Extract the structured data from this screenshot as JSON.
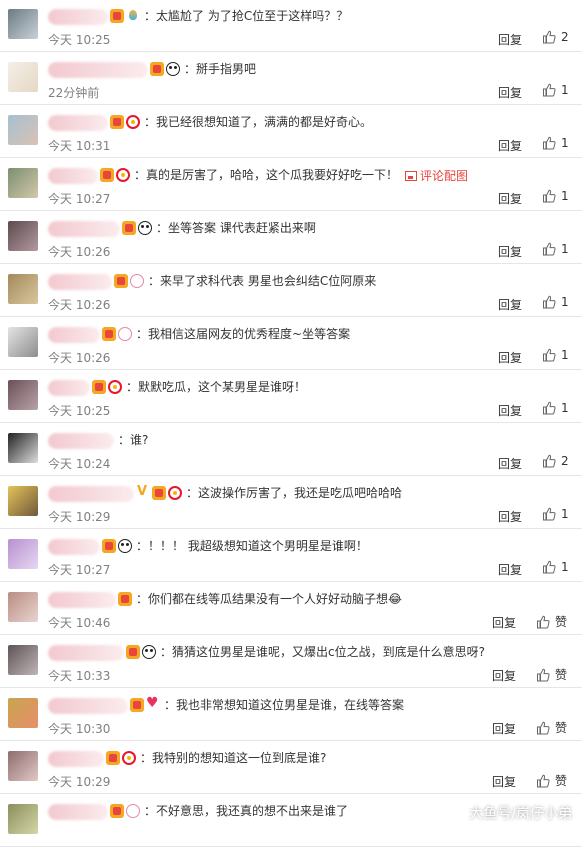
{
  "comments": [
    {
      "avatar_colors": [
        "#6b7b84",
        "#c9d1d6"
      ],
      "badges": [
        "vip",
        "bulb"
      ],
      "name_w": 60,
      "text": "太尴尬了 为了抢C位至于这样吗？？",
      "time": "今天 10:25",
      "reply": "回复",
      "likes": "2"
    },
    {
      "avatar_colors": [
        "#f3efe8",
        "#e6d8c4"
      ],
      "badges": [
        "vip",
        "panda"
      ],
      "name_w": 100,
      "text": "掰手指男吧",
      "time": "22分钟前",
      "reply": "回复",
      "likes": "1"
    },
    {
      "avatar_colors": [
        "#a6c0cf",
        "#d9c2b6"
      ],
      "badges": [
        "vip",
        "weibo"
      ],
      "name_w": 60,
      "text": "我已经很想知道了，满满的都是好奇心。",
      "time": "今天 10:31",
      "reply": "回复",
      "likes": "1"
    },
    {
      "avatar_colors": [
        "#7b8f71",
        "#d4c7a9"
      ],
      "badges": [
        "vip",
        "weibo"
      ],
      "name_w": 50,
      "text": "真的是厉害了，哈哈，这个瓜我要好好吃一下！",
      "time": "今天 10:27",
      "reply": "回复",
      "likes": "1",
      "pic_link": "评论配图"
    },
    {
      "avatar_colors": [
        "#5b4a4d",
        "#b49aa0"
      ],
      "badges": [
        "vip",
        "panda"
      ],
      "name_w": 72,
      "text": "坐等答案 课代表赶紧出来啊",
      "time": "今天 10:26",
      "reply": "回复",
      "likes": "1"
    },
    {
      "avatar_colors": [
        "#a38a5c",
        "#d8c79c"
      ],
      "badges": [
        "vip",
        "rabbit"
      ],
      "name_w": 64,
      "text": "来早了求科代表 男星也会纠结C位阿原来",
      "time": "今天 10:26",
      "reply": "回复",
      "likes": "1"
    },
    {
      "avatar_colors": [
        "#e4e4e4",
        "#8d8d8d"
      ],
      "badges": [
        "vip",
        "rabbit"
      ],
      "name_w": 52,
      "text": "我相信这届网友的优秀程度~坐等答案",
      "time": "今天 10:26",
      "reply": "回复",
      "likes": "1"
    },
    {
      "avatar_colors": [
        "#6b4f57",
        "#b9a4a8"
      ],
      "badges": [
        "vip",
        "weibo"
      ],
      "name_w": 42,
      "text": "默默吃瓜，这个某男星是谁呀！",
      "time": "今天 10:25",
      "reply": "回复",
      "likes": "1"
    },
    {
      "avatar_colors": [
        "#222222",
        "#dddddd"
      ],
      "badges": [],
      "name_w": 66,
      "text": "谁?",
      "time": "今天 10:24",
      "reply": "回复",
      "likes": "2"
    },
    {
      "avatar_colors": [
        "#e5c25a",
        "#6e5a3a"
      ],
      "badges": [
        "v",
        "vip",
        "weibo"
      ],
      "name_w": 86,
      "text": "这波操作厉害了，我还是吃瓜吧哈哈哈",
      "time": "今天 10:29",
      "reply": "回复",
      "likes": "1"
    },
    {
      "avatar_colors": [
        "#b790d1",
        "#e7d7f1"
      ],
      "badges": [
        "vip",
        "panda"
      ],
      "name_w": 52,
      "text": "！！！ 我超级想知道这个男明星是谁啊！",
      "time": "今天 10:27",
      "reply": "回复",
      "likes": "1"
    },
    {
      "avatar_colors": [
        "#b98d83",
        "#e9d4cf"
      ],
      "badges": [
        "vip"
      ],
      "name_w": 68,
      "text": "你们都在线等瓜结果没有一个人好好动脑子想😂",
      "time": "今天 10:46",
      "reply": "回复",
      "likes": "赞"
    },
    {
      "avatar_colors": [
        "#5e5355",
        "#c1b6b7"
      ],
      "badges": [
        "vip",
        "panda"
      ],
      "name_w": 76,
      "text": "猜猜这位男星是谁呢，又爆出c位之战，到底是什么意思呀?",
      "time": "今天 10:33",
      "reply": "回复",
      "likes": "赞"
    },
    {
      "avatar_colors": [
        "#c8a44f",
        "#e88f6a"
      ],
      "badges": [
        "vip",
        "heart"
      ],
      "name_w": 80,
      "text": "我也非常想知道这位男星是谁，在线等答案",
      "time": "今天 10:30",
      "reply": "回复",
      "likes": "赞"
    },
    {
      "avatar_colors": [
        "#8e6c6d",
        "#e0c9c6"
      ],
      "badges": [
        "vip",
        "weibo"
      ],
      "name_w": 56,
      "text": "我特别的想知道这一位到底是谁?",
      "time": "今天 10:29",
      "reply": "回复",
      "likes": "赞"
    },
    {
      "avatar_colors": [
        "#8c8f5b",
        "#d4d6a9"
      ],
      "badges": [
        "vip",
        "rabbit"
      ],
      "name_w": 60,
      "text": "不好意思，我还真的想不出来是谁了",
      "time": "",
      "reply": "",
      "likes": ""
    }
  ],
  "watermark": "大鱼号/岚仔小弟"
}
